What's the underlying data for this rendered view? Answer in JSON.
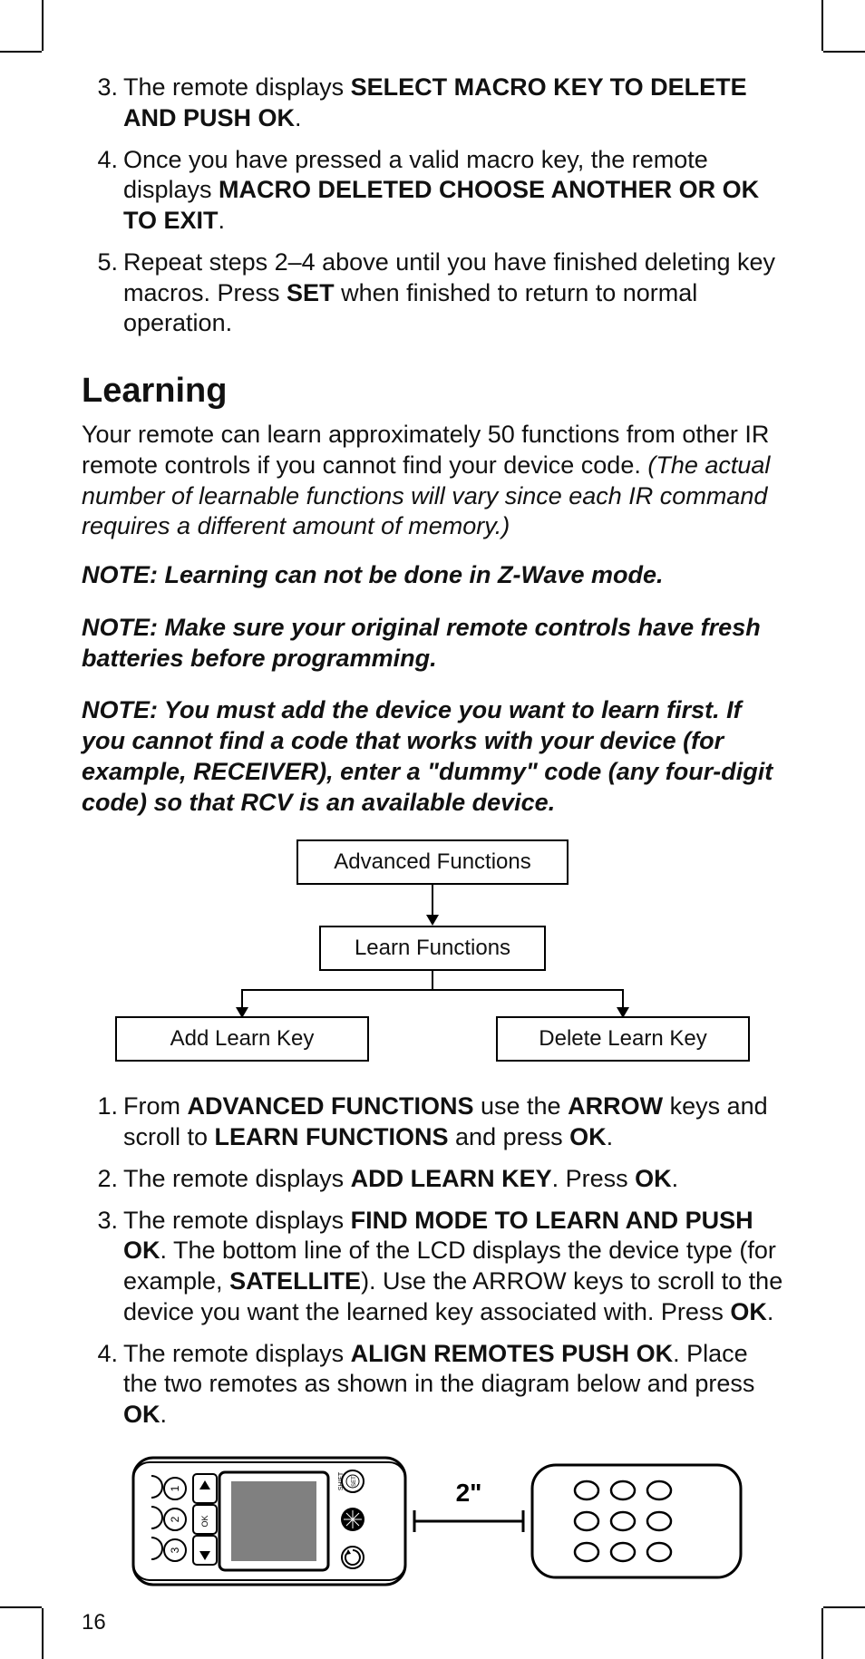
{
  "page_number": "16",
  "list_a": {
    "items": [
      {
        "num": "3.",
        "parts": [
          "The remote displays ",
          "SELECT MACRO KEY TO DELETE AND PUSH OK",
          "."
        ]
      },
      {
        "num": "4.",
        "parts": [
          "Once you have pressed a valid macro key, the remote displays ",
          "MACRO DELETED CHOOSE ANOTHER OR OK TO EXIT",
          "."
        ]
      },
      {
        "num": "5.",
        "parts": [
          "Repeat steps 2–4 above until you have finished deleting key macros. Press ",
          "SET",
          " when finished to return to normal operation."
        ]
      }
    ]
  },
  "heading": "Learning",
  "intro": {
    "plain": "Your remote can learn approximately 50 functions from other IR remote controls if you cannot find your device code. ",
    "italic": "(The actual number of learnable functions will vary since each IR command requires a different amount of memory.)"
  },
  "notes": [
    "NOTE: Learning can not be done in Z-Wave mode.",
    "NOTE: Make sure your original remote controls have fresh batteries before programming.",
    "NOTE: You must add the device you want to learn first. If you cannot find a code that works with your device (for example, RECEIVER), enter a \"dummy\" code (any four-digit code) so that RCV is an available device."
  ],
  "flow": {
    "top": "Advanced Functions",
    "mid": "Learn Functions",
    "left": "Add Learn Key",
    "right": "Delete Learn Key"
  },
  "list_b": {
    "items": [
      {
        "num": "1.",
        "segs": [
          {
            "t": "From "
          },
          {
            "b": "ADVANCED FUNCTIONS"
          },
          {
            "t": " use the "
          },
          {
            "b": "ARROW"
          },
          {
            "t": " keys and scroll to "
          },
          {
            "b": "LEARN FUNCTIONS"
          },
          {
            "t": " and press "
          },
          {
            "b": "OK"
          },
          {
            "t": "."
          }
        ]
      },
      {
        "num": "2.",
        "segs": [
          {
            "t": "The remote displays "
          },
          {
            "b": "ADD LEARN KEY"
          },
          {
            "t": ". Press "
          },
          {
            "b": "OK"
          },
          {
            "t": "."
          }
        ]
      },
      {
        "num": "3.",
        "segs": [
          {
            "t": "The remote displays "
          },
          {
            "b": "FIND MODE TO LEARN AND PUSH OK"
          },
          {
            "t": ". The bottom line of the LCD displays the device type (for example, "
          },
          {
            "b": "SATELLITE"
          },
          {
            "t": "). Use the ARROW keys to scroll to the device you want the learned key associated with. Press "
          },
          {
            "b": "OK"
          },
          {
            "t": "."
          }
        ]
      },
      {
        "num": "4.",
        "segs": [
          {
            "t": "The remote displays "
          },
          {
            "b": "ALIGN REMOTES PUSH OK"
          },
          {
            "t": ". Place the two remotes as shown in the diagram below and press "
          },
          {
            "b": "OK"
          },
          {
            "t": "."
          }
        ]
      }
    ]
  },
  "diagram": {
    "distance": "2\"",
    "remote_labels": {
      "set": "SET",
      "shift": "SHIFT",
      "ok": "OK",
      "n1": "1",
      "n2": "2",
      "n3": "3"
    }
  }
}
